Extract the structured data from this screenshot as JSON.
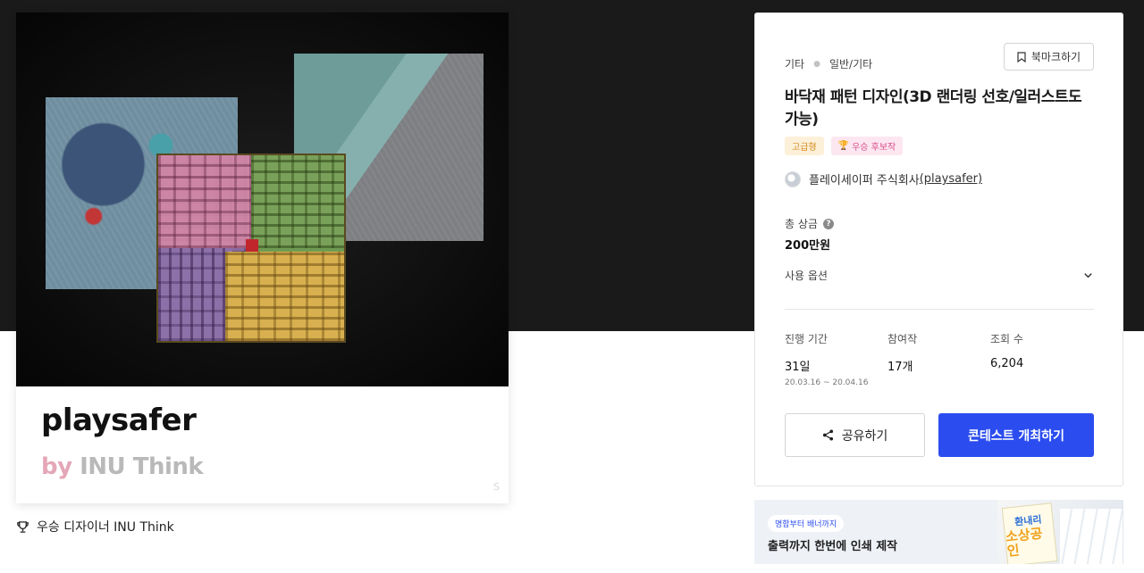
{
  "artwork": {
    "title": "playsafer",
    "byline_by": "by",
    "byline_name": "INU Think",
    "watermark": "S"
  },
  "winner": {
    "label": "우승 디자이너 INU Think",
    "icon": "trophy-icon"
  },
  "contest": {
    "breadcrumb": [
      "기타",
      "일반/기타"
    ],
    "bookmark_label": "북마크하기",
    "title": "바닥재 패턴 디자인(3D 랜더링 선호/일러스트도 가능)",
    "badges": {
      "grade": "고급형",
      "winner": "우승 후보작"
    },
    "company": {
      "name": "플레이세이퍼 주식회사",
      "handle": "(playsafer)"
    },
    "prize": {
      "label": "총 상금",
      "help": "?",
      "value": "200만원"
    },
    "usage_label": "사용 옵션",
    "stats": {
      "period_label": "진행 기간",
      "period_value": "31일",
      "period_dates": "20.03.16 ~ 20.04.16",
      "entries_label": "참여작",
      "entries_value": "17개",
      "views_label": "조회 수",
      "views_value": "6,204"
    },
    "share_label": "공유하기",
    "host_label": "콘테스트 개최하기"
  },
  "banner": {
    "pill": "명함부터 배너까지",
    "text": "출력까지 한번에 인쇄 제작",
    "book_line1": "환내리",
    "book_line2": "소상공인"
  },
  "colors": {
    "top_band": "#1b1a1b",
    "primary": "#2b4df0",
    "grade_badge": "#d48a1e",
    "winner_badge": "#d94f8b"
  }
}
